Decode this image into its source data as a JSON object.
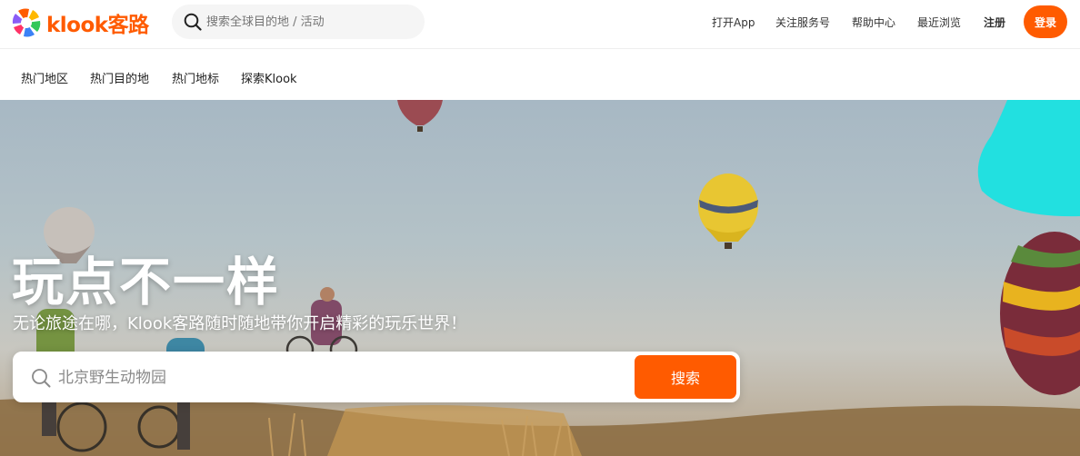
{
  "brand": {
    "name": "klook客路",
    "color": "#ff5b00"
  },
  "header": {
    "search_placeholder": "搜索全球目的地 / 活动",
    "links": {
      "app": "打开App",
      "follow": "关注服务号",
      "help": "帮助中心",
      "recent": "最近浏览",
      "register": "注册"
    },
    "login_label": "登录"
  },
  "subnav": {
    "items": [
      {
        "label": "热门地区"
      },
      {
        "label": "热门目的地"
      },
      {
        "label": "热门地标"
      },
      {
        "label": "探索Klook"
      }
    ]
  },
  "hero": {
    "title": "玩点不一样",
    "subtitle": "无论旅途在哪，Klook客路随时随地带你开启精彩的玩乐世界！",
    "search_placeholder": "北京野生动物园",
    "search_button": "搜索",
    "accent_color": "#22e0e0"
  }
}
